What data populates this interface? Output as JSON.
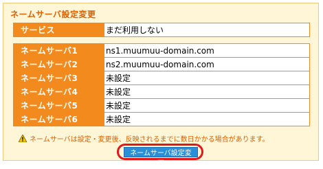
{
  "panel": {
    "title": "ネームサーバ設定変更",
    "service": {
      "label": "サービス",
      "value": "まだ利用しない"
    },
    "nameservers": [
      {
        "label": "ネームサーバ1",
        "value": "ns1.muumuu-domain.com"
      },
      {
        "label": "ネームサーバ2",
        "value": "ns2.muumuu-domain.com"
      },
      {
        "label": "ネームサーバ3",
        "value": "未設定"
      },
      {
        "label": "ネームサーバ4",
        "value": "未設定"
      },
      {
        "label": "ネームサーバ5",
        "value": "未設定"
      },
      {
        "label": "ネームサーバ6",
        "value": "未設定"
      }
    ],
    "note": "ネームサーバは設定・変更後、反映されるまでに数日かかる場合があります。",
    "submit_label": "ネームサーバ設定変更"
  },
  "colors": {
    "accent": "#f28a1e",
    "title": "#e06000",
    "background": "#fff6d8",
    "button": "#2a8fd6",
    "highlight": "#e01818"
  },
  "icons": {
    "warning": "warning-icon"
  }
}
